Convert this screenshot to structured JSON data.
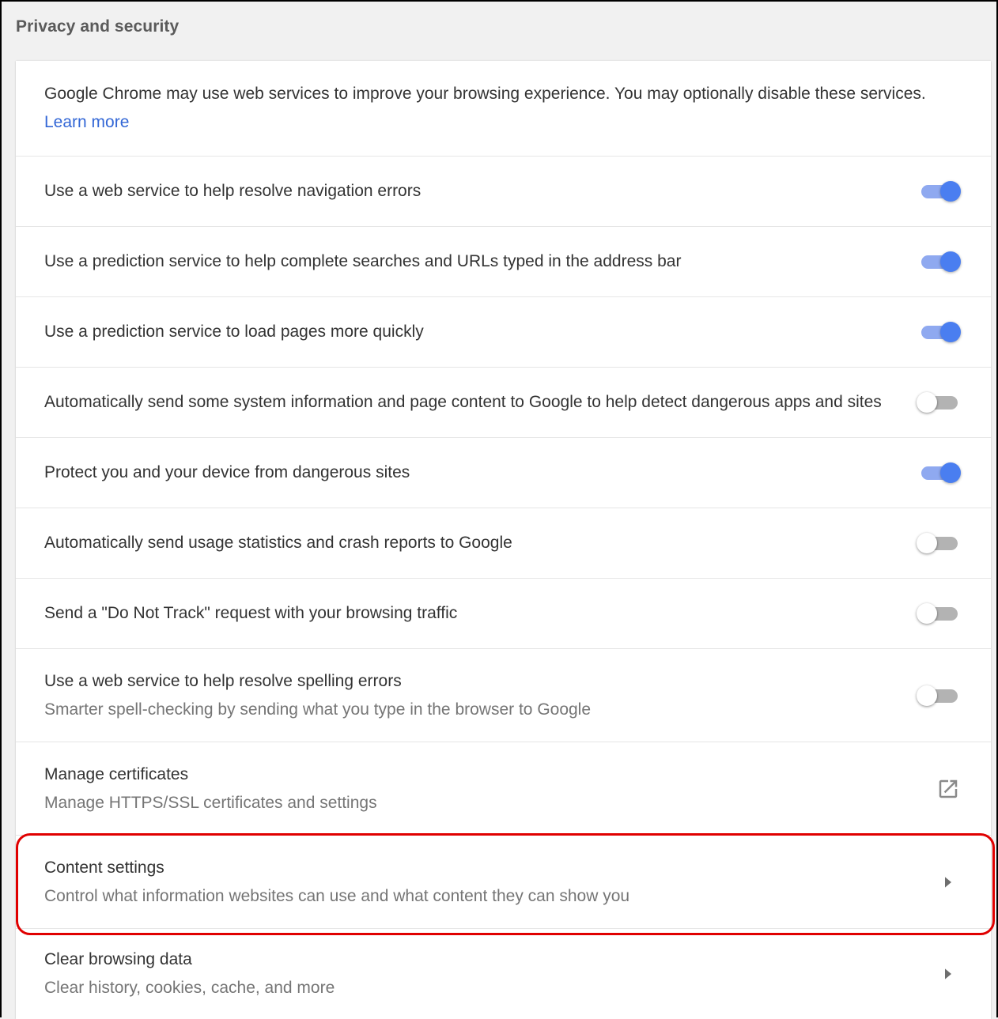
{
  "section": {
    "title": "Privacy and security"
  },
  "intro": {
    "text": "Google Chrome may use web services to improve your browsing experience. You may optionally disable these services.",
    "link_label": "Learn more"
  },
  "toggles": [
    {
      "label": "Use a web service to help resolve navigation errors",
      "checked": true
    },
    {
      "label": "Use a prediction service to help complete searches and URLs typed in the address bar",
      "checked": true
    },
    {
      "label": "Use a prediction service to load pages more quickly",
      "checked": true
    },
    {
      "label": "Automatically send some system information and page content to Google to help detect dangerous apps and sites",
      "checked": false
    },
    {
      "label": "Protect you and your device from dangerous sites",
      "checked": true
    },
    {
      "label": "Automatically send usage statistics and crash reports to Google",
      "checked": false
    },
    {
      "label": "Send a \"Do Not Track\" request with your browsing traffic",
      "checked": false
    },
    {
      "label": "Use a web service to help resolve spelling errors",
      "sublabel": "Smarter spell-checking by sending what you type in the browser to Google",
      "checked": false
    }
  ],
  "links": [
    {
      "label": "Manage certificates",
      "sublabel": "Manage HTTPS/SSL certificates and settings",
      "icon": "external-link-icon"
    },
    {
      "label": "Content settings",
      "sublabel": "Control what information websites can use and what content they can show you",
      "icon": "chevron-right-icon",
      "highlighted": true
    },
    {
      "label": "Clear browsing data",
      "sublabel": "Clear history, cookies, cache, and more",
      "icon": "chevron-right-icon"
    }
  ],
  "colors": {
    "accent": "#4a7ef0",
    "link": "#3367d6",
    "highlight": "#e00000"
  }
}
